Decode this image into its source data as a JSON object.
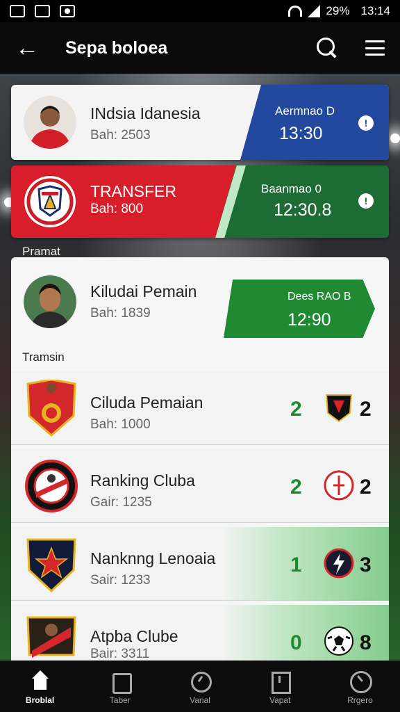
{
  "status_bar": {
    "battery": "29%",
    "time": "13:14"
  },
  "app_bar": {
    "title": "Sepa boloea"
  },
  "cards": [
    {
      "name": "INdsia Idanesia",
      "sub": "Bah: 2503",
      "panel_label": "Aermnao D",
      "panel_time": "13:30",
      "panel_icon": "!",
      "accent": "#23499e"
    },
    {
      "name": "TRANSFER",
      "sub": "Bah: 800",
      "panel_label": "Baanmao 0",
      "panel_time": "12:30.8",
      "panel_icon": "!",
      "accent": "#d71e2a"
    }
  ],
  "section_labels": {
    "first": "Pramat",
    "second": "Tramsin"
  },
  "featured": {
    "name": "Kiludai Pemain",
    "sub": "Bah: 1839",
    "panel_label": "Dees RAO B",
    "panel_time": "12:90",
    "accent": "#1f8a32"
  },
  "rows": [
    {
      "name": "Ciluda Pemaian",
      "sub": "Bah: 1000",
      "score_a": "2",
      "score_b": "2"
    },
    {
      "name": "Ranking Cluba",
      "sub": "Gair: 1235",
      "score_a": "2",
      "score_b": "2"
    },
    {
      "name": "Nanknng Lenoaia",
      "sub": "Sair: 1233",
      "score_a": "1",
      "score_b": "3"
    },
    {
      "name": "Atpba Clube",
      "sub": "Bair: 3311",
      "score_a": "0",
      "score_b": "8"
    }
  ],
  "bottom_nav": [
    {
      "label": "Broblal",
      "icon": "home-icon",
      "active": true
    },
    {
      "label": "Taber",
      "icon": "shirt-icon",
      "active": false
    },
    {
      "label": "Vanal",
      "icon": "clock-icon",
      "active": false
    },
    {
      "label": "Vapat",
      "icon": "board-icon",
      "active": false
    },
    {
      "label": "Rrgero",
      "icon": "gauge-icon",
      "active": false
    }
  ]
}
